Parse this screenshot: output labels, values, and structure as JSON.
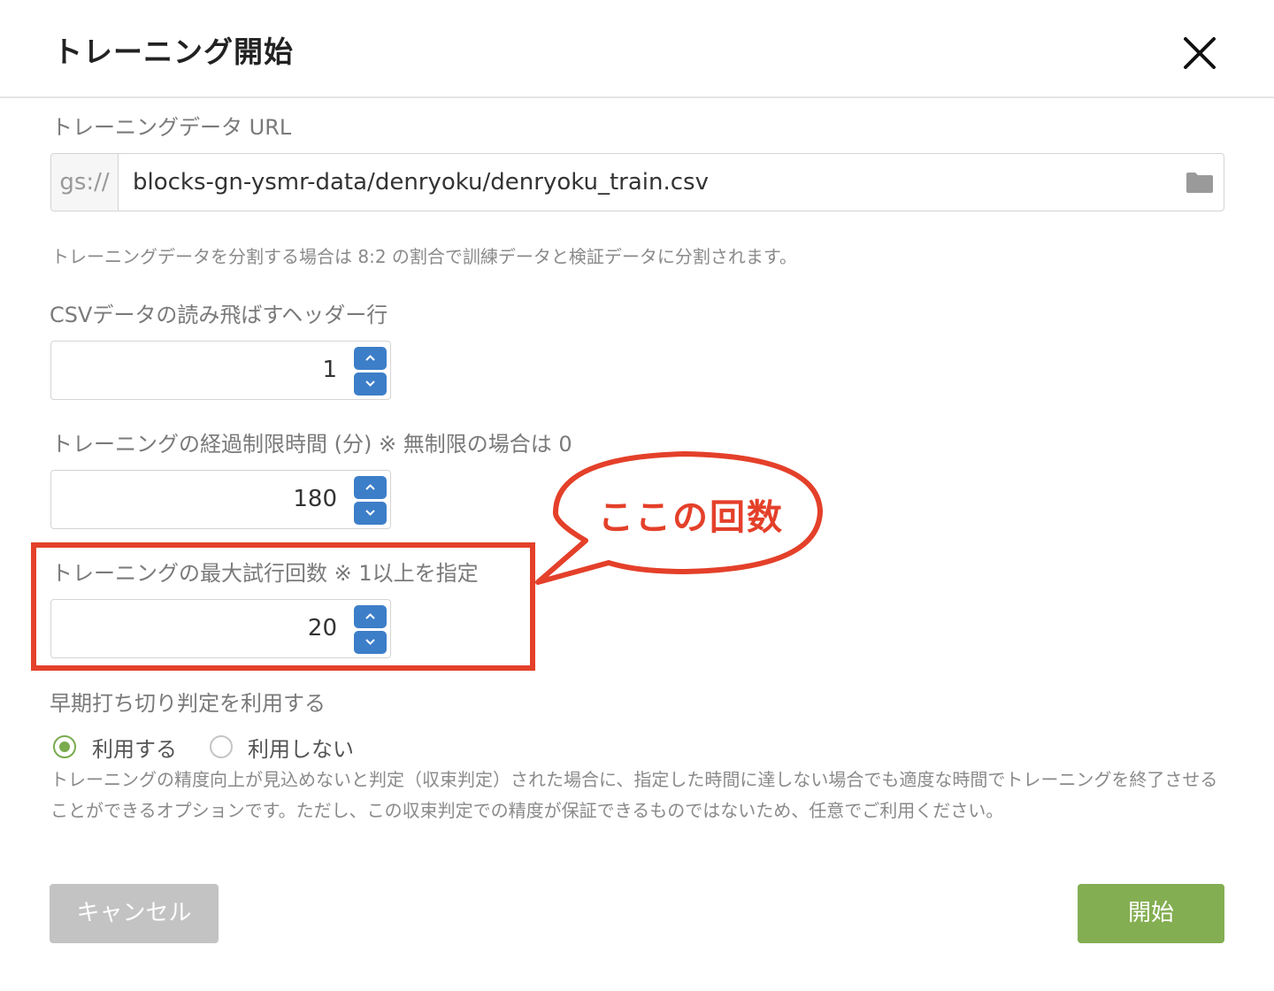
{
  "dialog": {
    "title": "トレーニング開始"
  },
  "training_data": {
    "label": "トレーニングデータ URL",
    "prefix": "gs://",
    "value": "blocks-gn-ysmr-data/denryoku/denryoku_train.csv",
    "hint": "トレーニングデータを分割する場合は 8:2 の割合で訓練データと検証データに分割されます。"
  },
  "skip_header": {
    "label": "CSVデータの読み飛ばすヘッダー行",
    "value": "1"
  },
  "time_limit": {
    "label": "トレーニングの経過制限時間 (分) ※ 無制限の場合は 0",
    "value": "180"
  },
  "max_trials": {
    "label": "トレーニングの最大試行回数 ※ 1以上を指定",
    "value": "20"
  },
  "callout": {
    "text": "ここの回数",
    "color": "#e4402a"
  },
  "early_stopping": {
    "label": "早期打ち切り判定を利用する",
    "options": [
      {
        "label": "利用する",
        "selected": true
      },
      {
        "label": "利用しない",
        "selected": false
      }
    ],
    "description": "トレーニングの精度向上が見込めないと判定（収束判定）された場合に、指定した時間に達しない場合でも適度な時間でトレーニングを終了させることができるオプションです。ただし、この収束判定での精度が保証できるものではないため、任意でご利用ください。"
  },
  "buttons": {
    "cancel": "キャンセル",
    "start": "開始"
  },
  "colors": {
    "accent_green": "#84ae52",
    "spinner_blue": "#3d7ec8",
    "cancel_gray": "#c3c3c3"
  }
}
